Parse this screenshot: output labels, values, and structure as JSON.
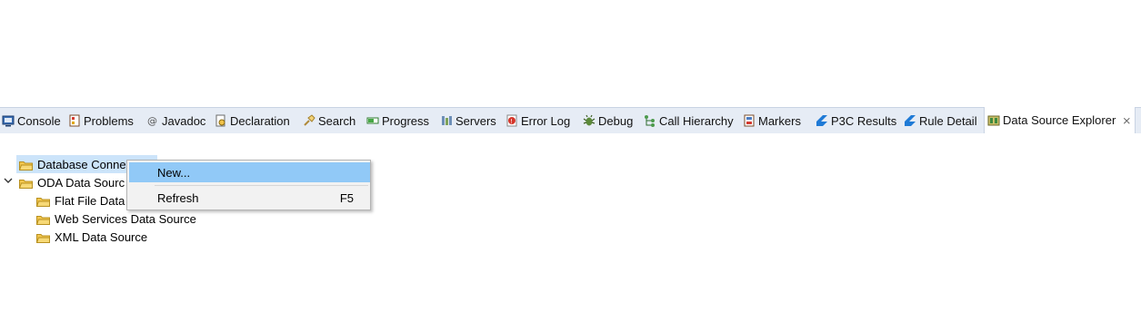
{
  "tabs": [
    {
      "label": "Console",
      "icon": "console-icon"
    },
    {
      "label": "Problems",
      "icon": "problems-icon"
    },
    {
      "label": "Javadoc",
      "icon": "javadoc-icon"
    },
    {
      "label": "Declaration",
      "icon": "declaration-icon"
    },
    {
      "label": "Search",
      "icon": "search-icon"
    },
    {
      "label": "Progress",
      "icon": "progress-icon"
    },
    {
      "label": "Servers",
      "icon": "servers-icon"
    },
    {
      "label": "Error Log",
      "icon": "error-log-icon"
    },
    {
      "label": "Debug",
      "icon": "debug-icon"
    },
    {
      "label": "Call Hierarchy",
      "icon": "call-hierarchy-icon"
    },
    {
      "label": "Markers",
      "icon": "markers-icon"
    },
    {
      "label": "P3C Results",
      "icon": "p3c-results-icon"
    },
    {
      "label": "Rule Detail",
      "icon": "rule-detail-icon"
    },
    {
      "label": "Data Source Explorer",
      "icon": "data-source-explorer-icon",
      "active": true
    }
  ],
  "tab_close_glyph": "⨯",
  "tree": {
    "items": [
      {
        "label": "Database Conne",
        "selected": true
      },
      {
        "label": "ODA Data Sourc",
        "expanded": true
      },
      {
        "label": "Flat File Data"
      },
      {
        "label": "Web Services Data Source"
      },
      {
        "label": "XML Data Source"
      }
    ]
  },
  "context_menu": {
    "items": [
      {
        "label": "New...",
        "shortcut": ""
      },
      {
        "label": "Refresh",
        "shortcut": "F5"
      }
    ]
  },
  "colors": {
    "tab_bar_bg": "#e6ecf5",
    "selection_bg": "#cce4fa",
    "menu_hover_bg": "#91c9f7",
    "folder_yellow": "#f3c74f"
  }
}
